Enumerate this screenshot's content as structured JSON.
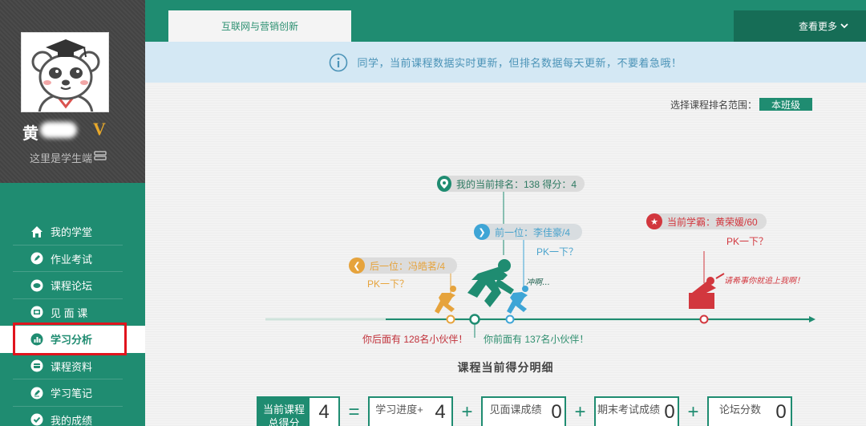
{
  "sidebar": {
    "user_name": "黄",
    "vip_badge": "V",
    "role": "这里是学生端",
    "items": [
      {
        "label": "我的学堂",
        "icon": "home-icon"
      },
      {
        "label": "作业考试",
        "icon": "pencil-icon"
      },
      {
        "label": "课程论坛",
        "icon": "chat-icon"
      },
      {
        "label": "见 面 课",
        "icon": "screen-icon"
      },
      {
        "label": "学习分析",
        "icon": "bar-chart-icon",
        "active": true
      },
      {
        "label": "课程资料",
        "icon": "folder-icon"
      },
      {
        "label": "学习笔记",
        "icon": "note-icon"
      },
      {
        "label": "我的成绩",
        "icon": "check-icon"
      }
    ]
  },
  "header": {
    "course_tab": "互联网与营销创新",
    "more_label": "查看更多"
  },
  "notice": {
    "text": "同学，当前课程数据实时更新，但排名数据每天更新，不要着急哦！"
  },
  "ranking": {
    "range_label": "选择课程排名范围：",
    "range_value": "本班级",
    "me": "我的当前排名：138 得分：4",
    "ahead": "前一位：李佳豪/4",
    "behind": "后一位：冯皓茗/4",
    "top": "当前学霸：黄荣媛/60",
    "pk_label": "PK一下？",
    "ahead_shout": "冲啊...",
    "top_shout": "请希事你就追上我啊！",
    "behind_count": "你后面有 128名小伙伴！",
    "ahead_count": "你前面有 137名小伙伴！",
    "progress_fraction_me": 0.5,
    "progress_fraction_top": 1.0
  },
  "score": {
    "title": "课程当前得分明细",
    "total_label": "当前课程总得分",
    "total_value": "4",
    "eq": "=",
    "plus": "+",
    "parts": [
      {
        "label": "学习进度+",
        "value": "4"
      },
      {
        "label": "见面课成绩",
        "value": "0"
      },
      {
        "label": "期末考试成绩",
        "value": "0"
      },
      {
        "label": "论坛分数",
        "value": "0"
      }
    ]
  },
  "colors": {
    "brand": "#1f8c71",
    "ahead": "#3ea5d6",
    "behind": "#e6a33c",
    "top": "#d2373e",
    "highlight": "#e0141d"
  }
}
